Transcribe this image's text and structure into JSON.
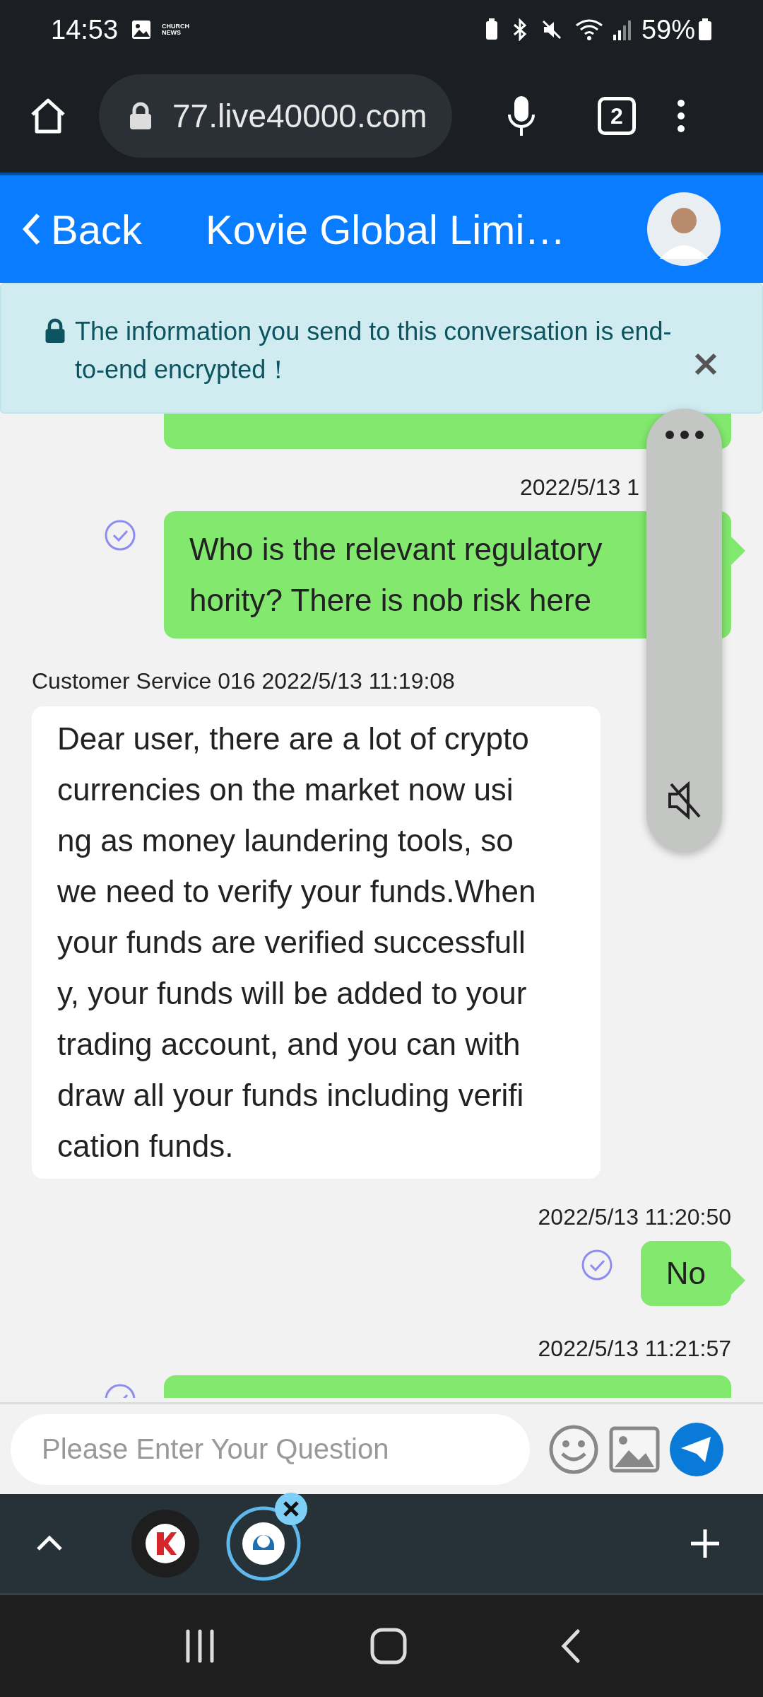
{
  "status_bar": {
    "time": "14:53",
    "news_badge": "CHURCH\nNEWS",
    "battery": "59%"
  },
  "browser": {
    "url": "77.live40000.com",
    "tab_count": "2"
  },
  "header": {
    "back": "Back",
    "title": "Kovie Global Limi…"
  },
  "notice": {
    "text": "The information you send to this conversation is end-to-end encrypted！"
  },
  "messages": [
    {
      "kind": "outgoing_cut_top"
    },
    {
      "kind": "outgoing",
      "time": [
        "2022/5/13 1"
      ],
      "read": true,
      "text": "Who is the relevant regulatory\nhority? There is nob risk here"
    },
    {
      "kind": "incoming",
      "sender": "Customer Service 016 2022/5/13 11:19:08",
      "text": "Dear user, there are a lot of crypto\ncurrencies on the market now usi\nng as money laundering tools, so\nwe need to verify your funds.When\nyour funds are verified successfull\ny, your funds will be added to your\ntrading account, and you can with\ndraw all your funds including verifi\ncation funds."
    },
    {
      "kind": "outgoing_short",
      "time": [
        "2022/5/13 11:20:50"
      ],
      "read": true,
      "text": "No"
    },
    {
      "kind": "outgoing_cut_bottom",
      "time": [
        "2022/5/13 11:21:57"
      ],
      "read": true
    }
  ],
  "composer": {
    "placeholder": "Please Enter Your Question"
  }
}
